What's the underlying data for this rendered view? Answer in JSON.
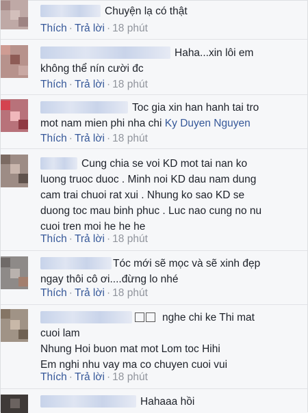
{
  "comments": [
    {
      "text": "Chuyện lạ có thật",
      "like": "Thích",
      "reply": "Trả lời",
      "dot": "·",
      "time": "18 phút"
    },
    {
      "text": "Haha...xin lôi em\nkhông thể nín cười đc",
      "like": "Thích",
      "reply": "Trả lời",
      "dot": "·",
      "time": "18 phút"
    },
    {
      "text": "Toc gia xin han hanh tai tro\nmot nam mien phi nha chi ",
      "mention": "Ky Duyen Nguyen",
      "like": "Thích",
      "reply": "Trả lời",
      "dot": "·",
      "time": "18 phút"
    },
    {
      "text": "Cung chia se voi KD mot tai nan ko\nluong truoc duoc . Minh noi KD dau nam dung\ncam trai chuoi rat xui . Nhung ko sao KD se\nduong toc mau binh phuc . Luc nao cung no nu\ncuoi tren moi he he he",
      "like": "Thích",
      "reply": "Trả lời",
      "dot": "·",
      "time": "18 phút"
    },
    {
      "text": "Tóc mới sẽ mọc và sẽ xinh đẹp\nngay thôi cô ơi....đừng lo nhé",
      "like": "Thích",
      "reply": "Trả lời",
      "dot": "·",
      "time": "18 phút"
    },
    {
      "text": "nghe chi ke Thi mat\ncuoi lam\nNhung Hoi buon mat mot Lom toc Hihi\nEm nghi nhu vay ma co chuyen cuoi vui",
      "like": "Thích",
      "reply": "Trả lời",
      "dot": "·",
      "time": "18 phút"
    },
    {
      "text": "Hahaaa hồi"
    }
  ]
}
